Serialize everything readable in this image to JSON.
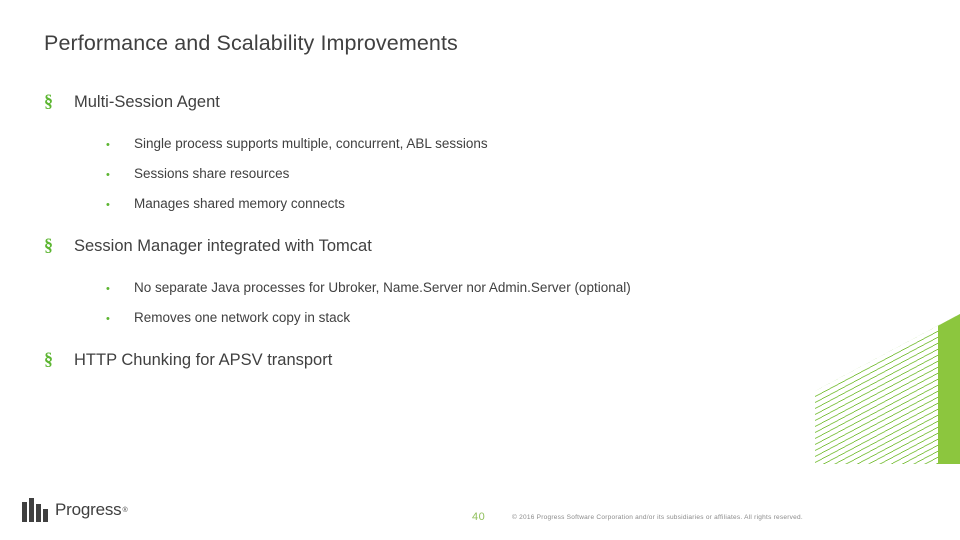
{
  "slide": {
    "title": "Performance and Scalability Improvements",
    "accent_color": "#5cb531",
    "text_color": "#404040",
    "bullets": [
      {
        "level": 1,
        "marker": "§",
        "text": "Multi-Session Agent"
      },
      {
        "level": 2,
        "marker": "•",
        "text": "Single process supports multiple, concurrent, ABL sessions"
      },
      {
        "level": 2,
        "marker": "•",
        "text": "Sessions share resources"
      },
      {
        "level": 2,
        "marker": "•",
        "text": "Manages shared memory connects"
      },
      {
        "level": 1,
        "marker": "§",
        "text": "Session Manager integrated with Tomcat"
      },
      {
        "level": 2,
        "marker": "•",
        "text": "No separate Java processes for Ubroker, Name.Server nor Admin.Server (optional)"
      },
      {
        "level": 2,
        "marker": "•",
        "text": "Removes one network copy in stack"
      },
      {
        "level": 1,
        "marker": "§",
        "text": "HTTP Chunking for APSV transport"
      }
    ]
  },
  "footer": {
    "logo_text": "Progress",
    "logo_registered": "®",
    "page_number": "40",
    "copyright": "© 2016 Progress Software Corporation and/or its subsidiaries or affiliates. All rights reserved."
  }
}
